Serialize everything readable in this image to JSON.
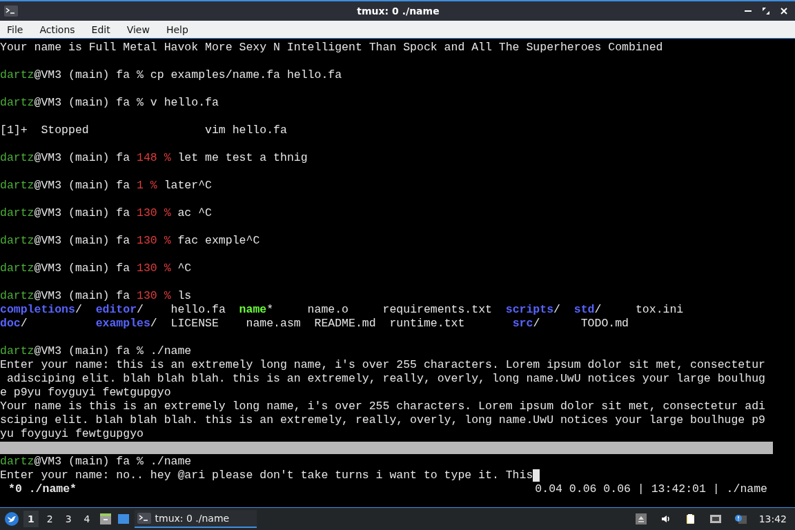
{
  "window": {
    "title": "tmux: 0 ./name"
  },
  "menu": [
    "File",
    "Actions",
    "Edit",
    "View",
    "Help"
  ],
  "terminal": {
    "lines": [
      {
        "kind": "text",
        "segments": [
          {
            "kind": "plain",
            "text": "Your name is Full Metal Havok More Sexy N Intelligent Than Spock and All The Superheroes Combined"
          }
        ]
      },
      {
        "kind": "blank"
      },
      {
        "kind": "text",
        "segments": [
          {
            "kind": "user",
            "text": "dartz"
          },
          {
            "kind": "plain",
            "text": "@VM3 (main) fa % cp examples/name.fa hello.fa"
          }
        ]
      },
      {
        "kind": "blank"
      },
      {
        "kind": "text",
        "segments": [
          {
            "kind": "user",
            "text": "dartz"
          },
          {
            "kind": "plain",
            "text": "@VM3 (main) fa % v hello.fa"
          }
        ]
      },
      {
        "kind": "blank"
      },
      {
        "kind": "text",
        "segments": [
          {
            "kind": "plain",
            "text": "[1]+  Stopped                 vim hello.fa"
          }
        ]
      },
      {
        "kind": "blank"
      },
      {
        "kind": "text",
        "segments": [
          {
            "kind": "user",
            "text": "dartz"
          },
          {
            "kind": "plain",
            "text": "@VM3 (main) fa "
          },
          {
            "kind": "error",
            "text": "148 %"
          },
          {
            "kind": "plain",
            "text": " let me test a thnig"
          }
        ]
      },
      {
        "kind": "blank"
      },
      {
        "kind": "text",
        "segments": [
          {
            "kind": "user",
            "text": "dartz"
          },
          {
            "kind": "plain",
            "text": "@VM3 (main) fa "
          },
          {
            "kind": "error",
            "text": "1 %"
          },
          {
            "kind": "plain",
            "text": " later^C"
          }
        ]
      },
      {
        "kind": "blank"
      },
      {
        "kind": "text",
        "segments": [
          {
            "kind": "user",
            "text": "dartz"
          },
          {
            "kind": "plain",
            "text": "@VM3 (main) fa "
          },
          {
            "kind": "error",
            "text": "130 %"
          },
          {
            "kind": "plain",
            "text": " ac ^C"
          }
        ]
      },
      {
        "kind": "blank"
      },
      {
        "kind": "text",
        "segments": [
          {
            "kind": "user",
            "text": "dartz"
          },
          {
            "kind": "plain",
            "text": "@VM3 (main) fa "
          },
          {
            "kind": "error",
            "text": "130 %"
          },
          {
            "kind": "plain",
            "text": " fac exmple^C"
          }
        ]
      },
      {
        "kind": "blank"
      },
      {
        "kind": "text",
        "segments": [
          {
            "kind": "user",
            "text": "dartz"
          },
          {
            "kind": "plain",
            "text": "@VM3 (main) fa "
          },
          {
            "kind": "error",
            "text": "130 %"
          },
          {
            "kind": "plain",
            "text": " ^C"
          }
        ]
      },
      {
        "kind": "blank"
      },
      {
        "kind": "text",
        "segments": [
          {
            "kind": "user",
            "text": "dartz"
          },
          {
            "kind": "plain",
            "text": "@VM3 (main) fa "
          },
          {
            "kind": "error",
            "text": "130 %"
          },
          {
            "kind": "plain",
            "text": " ls"
          }
        ]
      },
      {
        "kind": "text",
        "segments": [
          {
            "kind": "dir",
            "text": "completions"
          },
          {
            "kind": "plain",
            "text": "/  "
          },
          {
            "kind": "dir",
            "text": "editor"
          },
          {
            "kind": "plain",
            "text": "/    hello.fa  "
          },
          {
            "kind": "exec",
            "text": "name"
          },
          {
            "kind": "plain",
            "text": "*     name.o     requirements.txt  "
          },
          {
            "kind": "dir",
            "text": "scripts"
          },
          {
            "kind": "plain",
            "text": "/  "
          },
          {
            "kind": "dir",
            "text": "std"
          },
          {
            "kind": "plain",
            "text": "/     tox.ini"
          }
        ]
      },
      {
        "kind": "text",
        "segments": [
          {
            "kind": "dir",
            "text": "doc"
          },
          {
            "kind": "plain",
            "text": "/          "
          },
          {
            "kind": "dir",
            "text": "examples"
          },
          {
            "kind": "plain",
            "text": "/  LICENSE    name.asm  README.md  runtime.txt       "
          },
          {
            "kind": "dir",
            "text": "src"
          },
          {
            "kind": "plain",
            "text": "/      TODO.md"
          }
        ]
      },
      {
        "kind": "blank"
      },
      {
        "kind": "text",
        "segments": [
          {
            "kind": "user",
            "text": "dartz"
          },
          {
            "kind": "plain",
            "text": "@VM3 (main) fa % ./name"
          }
        ]
      },
      {
        "kind": "text",
        "segments": [
          {
            "kind": "plain",
            "text": "Enter your name: this is an extremely long name, i's over 255 characters. Lorem ipsum dolor sit met, consectetur"
          }
        ]
      },
      {
        "kind": "text",
        "segments": [
          {
            "kind": "plain",
            "text": " adisciping elit. blah blah blah. this is an extremely, really, overly, long name.UwU notices your large boulhug"
          }
        ]
      },
      {
        "kind": "text",
        "segments": [
          {
            "kind": "plain",
            "text": "e p9yu foyguyi fewtgupgyo"
          }
        ]
      },
      {
        "kind": "text",
        "segments": [
          {
            "kind": "plain",
            "text": "Your name is this is an extremely long name, i's over 255 characters. Lorem ipsum dolor sit met, consectetur adi"
          }
        ]
      },
      {
        "kind": "text",
        "segments": [
          {
            "kind": "plain",
            "text": "sciping elit. blah blah blah. this is an extremely, really, overly, long name.UwU notices your large boulhuge p9"
          }
        ]
      },
      {
        "kind": "text",
        "segments": [
          {
            "kind": "plain",
            "text": "yu foyguyi fewtgupgyo"
          }
        ]
      },
      {
        "kind": "bar"
      },
      {
        "kind": "text",
        "segments": [
          {
            "kind": "user",
            "text": "dartz"
          },
          {
            "kind": "plain",
            "text": "@VM3 (main) fa % ./name"
          }
        ]
      },
      {
        "kind": "text",
        "cursor": true,
        "segments": [
          {
            "kind": "plain",
            "text": "Enter your name: no.. hey @ari please don't take turns i want to type it. This"
          }
        ]
      }
    ]
  },
  "status_bar": {
    "left": "*0 ./name*",
    "right": "0.04 0.06 0.06 | 13:42:01 | ./name"
  },
  "taskbar": {
    "workspaces": [
      {
        "label": "1",
        "selected": true
      },
      {
        "label": "2",
        "selected": false
      },
      {
        "label": "3",
        "selected": false
      },
      {
        "label": "4",
        "selected": false
      }
    ],
    "task": {
      "label": "tmux: 0 ./name",
      "selected": true
    },
    "clock": "13:42"
  }
}
